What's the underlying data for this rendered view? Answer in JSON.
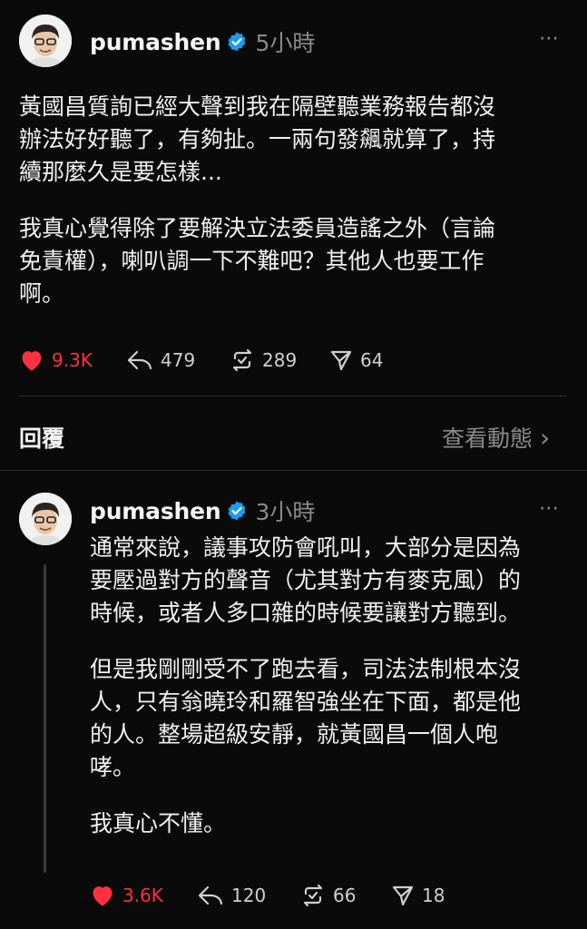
{
  "post1": {
    "username": "pumashen",
    "time": "5小時",
    "more_label": "⋯",
    "paragraphs": [
      [
        "黃國昌質詢已經大聲到我在隔壁聽業務報告都沒",
        "辦法好好聽了，有夠扯。一兩句發飆就算了，持",
        "續那麼久是要怎樣..."
      ],
      [
        "我真心覺得除了要解決立法委員造謠之外（言論",
        "免責權），喇叭調一下不難吧？其他人也要工作",
        "啊。"
      ]
    ],
    "likes": "9.3K",
    "replies": "479",
    "reposts": "289",
    "shares": "64"
  },
  "replies_bar": {
    "label": "回覆",
    "view_activity": "查看動態",
    "chevron": "›"
  },
  "post2": {
    "username": "pumashen",
    "time": "3小時",
    "more_label": "⋯",
    "paragraphs": [
      [
        "通常來說，議事攻防會吼叫，大部分是因為",
        "要壓過對方的聲音（尤其對方有麥克風）的",
        "時候，或者人多口雜的時候要讓對方聽到。"
      ],
      [
        "但是我剛剛受不了跑去看，司法法制根本沒",
        "人，只有翁曉玲和羅智強坐在下面，都是他",
        "的人。整場超級安靜，就黃國昌一個人咆",
        "哮。"
      ],
      [
        "我真心不懂。"
      ]
    ],
    "likes": "3.6K",
    "replies": "120",
    "reposts": "66",
    "shares": "18"
  },
  "colors": {
    "background": "#0a0a0a",
    "like_red": "#ff3040",
    "verified_blue": "#1d9bf0",
    "muted": "#8a8a8a"
  },
  "icons": [
    "heart-icon",
    "reply-icon",
    "repost-icon",
    "share-icon",
    "verified-badge-icon",
    "more-icon",
    "chevron-right-icon"
  ]
}
